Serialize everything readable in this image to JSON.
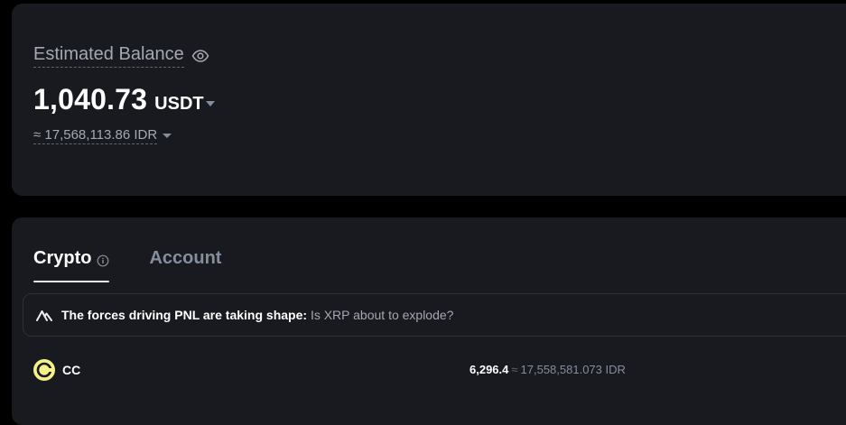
{
  "balance": {
    "label": "Estimated Balance",
    "amount": "1,040.73",
    "currency": "USDT",
    "fiat_approx": "≈ 17,568,113.86 IDR"
  },
  "tabs": [
    {
      "label": "Crypto",
      "active": true
    },
    {
      "label": "Account",
      "active": false
    }
  ],
  "banner": {
    "title": "The forces driving PNL are taking shape:",
    "link": "Is XRP about to explode?"
  },
  "assets": [
    {
      "symbol": "CC",
      "amount": "6,296.4",
      "approx_symbol": "≈",
      "fiat_value": "17,558,581.073 IDR"
    }
  ],
  "colors": {
    "background": "#000000",
    "card": "#181a20",
    "text_primary": "#ffffff",
    "text_secondary": "#a3a8b3",
    "coin_logo": "#f4f08a"
  },
  "icons": {
    "eye": "eye-icon",
    "info": "info-icon",
    "banner": "mountain-logo-icon",
    "coin": "cc-coin-icon"
  }
}
